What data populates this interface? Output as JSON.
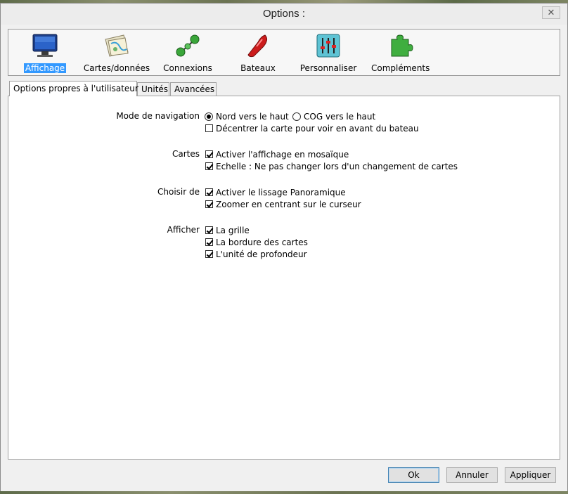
{
  "window": {
    "title": "Options :",
    "close_symbol": "✕"
  },
  "toolbar": {
    "items": [
      {
        "label": "Affichage",
        "icon": "monitor-icon",
        "active": true
      },
      {
        "label": "Cartes/données",
        "icon": "charts-icon",
        "active": false
      },
      {
        "label": "Connexions",
        "icon": "connections-icon",
        "active": false
      },
      {
        "label": "Bateaux",
        "icon": "boat-icon",
        "active": false
      },
      {
        "label": "Personnaliser",
        "icon": "sliders-icon",
        "active": false
      },
      {
        "label": "Compléments",
        "icon": "puzzle-icon",
        "active": false
      }
    ]
  },
  "tabs": [
    {
      "label": "Options propres à l'utilisateur",
      "active": true
    },
    {
      "label": "Unités",
      "active": false
    },
    {
      "label": "Avancées",
      "active": false
    }
  ],
  "groups": {
    "navigation": {
      "label": "Mode de navigation",
      "radio_north": {
        "label": "Nord vers le haut",
        "checked": true
      },
      "radio_cog": {
        "label": "COG vers le haut",
        "checked": false
      },
      "offset": {
        "label": "Décentrer la carte pour voir en avant du bateau",
        "checked": false
      }
    },
    "cartes": {
      "label": "Cartes",
      "mosaic": {
        "label": "Activer l'affichage en mosaïque",
        "checked": true
      },
      "scale": {
        "label": "Echelle : Ne pas changer lors d'un changement de cartes",
        "checked": true
      }
    },
    "choisir": {
      "label": "Choisir de",
      "smooth": {
        "label": "Activer le lissage Panoramique",
        "checked": true
      },
      "zoom": {
        "label": "Zoomer en centrant sur le curseur",
        "checked": true
      }
    },
    "afficher": {
      "label": "Afficher",
      "grid": {
        "label": "La grille",
        "checked": true
      },
      "border": {
        "label": "La bordure des cartes",
        "checked": true
      },
      "depth": {
        "label": "L'unité de profondeur",
        "checked": true
      }
    }
  },
  "buttons": {
    "ok": "Ok",
    "cancel": "Annuler",
    "apply": "Appliquer"
  },
  "colors": {
    "selection": "#3399ff",
    "window_bg": "#f0f0f0"
  }
}
